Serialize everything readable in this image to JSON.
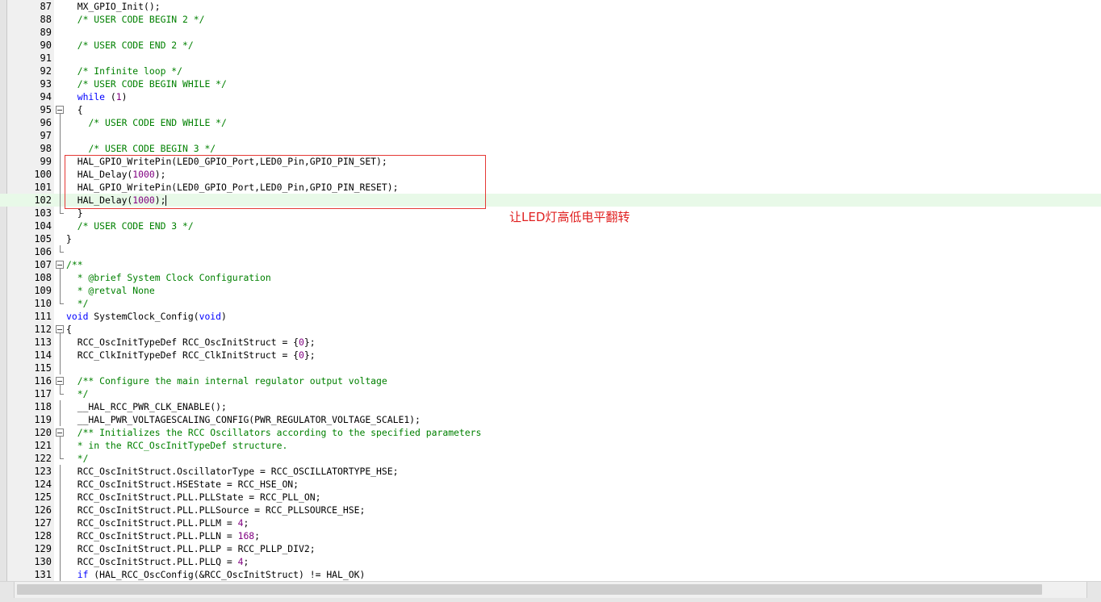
{
  "editor": {
    "lines": [
      {
        "n": "87",
        "code": [
          {
            "t": "  MX_GPIO_Init();"
          }
        ]
      },
      {
        "n": "88",
        "code": [
          {
            "t": "  "
          },
          {
            "t": "/* USER CODE BEGIN 2 */",
            "c": "cm"
          }
        ]
      },
      {
        "n": "89",
        "code": []
      },
      {
        "n": "90",
        "code": [
          {
            "t": "  "
          },
          {
            "t": "/* USER CODE END 2 */",
            "c": "cm"
          }
        ]
      },
      {
        "n": "91",
        "code": []
      },
      {
        "n": "92",
        "code": [
          {
            "t": "  "
          },
          {
            "t": "/* Infinite loop */",
            "c": "cm"
          }
        ]
      },
      {
        "n": "93",
        "code": [
          {
            "t": "  "
          },
          {
            "t": "/* USER CODE BEGIN WHILE */",
            "c": "cm"
          }
        ]
      },
      {
        "n": "94",
        "code": [
          {
            "t": "  "
          },
          {
            "t": "while",
            "c": "kw"
          },
          {
            "t": " ("
          },
          {
            "t": "1",
            "c": "num"
          },
          {
            "t": ")"
          }
        ]
      },
      {
        "n": "95",
        "code": [
          {
            "t": "  {"
          }
        ],
        "fold": "open"
      },
      {
        "n": "96",
        "code": [
          {
            "t": "    "
          },
          {
            "t": "/* USER CODE END WHILE */",
            "c": "cm"
          }
        ],
        "fold": "line"
      },
      {
        "n": "97",
        "code": [],
        "fold": "line"
      },
      {
        "n": "98",
        "code": [
          {
            "t": "    "
          },
          {
            "t": "/* USER CODE BEGIN 3 */",
            "c": "cm"
          }
        ],
        "fold": "line"
      },
      {
        "n": "99",
        "code": [
          {
            "t": "  HAL_GPIO_WritePin(LED0_GPIO_Port,LED0_Pin,GPIO_PIN_SET);"
          }
        ],
        "fold": "line"
      },
      {
        "n": "100",
        "code": [
          {
            "t": "  HAL_Delay("
          },
          {
            "t": "1000",
            "c": "num"
          },
          {
            "t": ");"
          }
        ],
        "fold": "line"
      },
      {
        "n": "101",
        "code": [
          {
            "t": "  HAL_GPIO_WritePin(LED0_GPIO_Port,LED0_Pin,GPIO_PIN_RESET);"
          }
        ],
        "fold": "line"
      },
      {
        "n": "102",
        "code": [
          {
            "t": "  HAL_Delay("
          },
          {
            "t": "1000",
            "c": "num"
          },
          {
            "t": ");"
          },
          {
            "caret": true
          }
        ],
        "fold": "line",
        "current": true
      },
      {
        "n": "103",
        "code": [
          {
            "t": "  }"
          }
        ],
        "fold": "end"
      },
      {
        "n": "104",
        "code": [
          {
            "t": "  "
          },
          {
            "t": "/* USER CODE END 3 */",
            "c": "cm"
          }
        ]
      },
      {
        "n": "105",
        "code": [
          {
            "t": "}"
          }
        ]
      },
      {
        "n": "106",
        "code": [],
        "fold": "end"
      },
      {
        "n": "107",
        "code": [
          {
            "t": "/**",
            "c": "cm"
          }
        ],
        "fold": "open"
      },
      {
        "n": "108",
        "code": [
          {
            "t": "  * @brief System Clock Configuration",
            "c": "cm"
          }
        ],
        "fold": "line"
      },
      {
        "n": "109",
        "code": [
          {
            "t": "  * @retval None",
            "c": "cm"
          }
        ],
        "fold": "line"
      },
      {
        "n": "110",
        "code": [
          {
            "t": "  */",
            "c": "cm"
          }
        ],
        "fold": "end"
      },
      {
        "n": "111",
        "code": [
          {
            "t": "void",
            "c": "kw"
          },
          {
            "t": " SystemClock_Config("
          },
          {
            "t": "void",
            "c": "kw"
          },
          {
            "t": ")"
          }
        ]
      },
      {
        "n": "112",
        "code": [
          {
            "t": "{"
          }
        ],
        "fold": "open"
      },
      {
        "n": "113",
        "code": [
          {
            "t": "  RCC_OscInitTypeDef RCC_OscInitStruct = {"
          },
          {
            "t": "0",
            "c": "num"
          },
          {
            "t": "};"
          }
        ],
        "fold": "line"
      },
      {
        "n": "114",
        "code": [
          {
            "t": "  RCC_ClkInitTypeDef RCC_ClkInitStruct = {"
          },
          {
            "t": "0",
            "c": "num"
          },
          {
            "t": "};"
          }
        ],
        "fold": "line"
      },
      {
        "n": "115",
        "code": [],
        "fold": "line"
      },
      {
        "n": "116",
        "code": [
          {
            "t": "  "
          },
          {
            "t": "/** Configure the main internal regulator output voltage",
            "c": "cm"
          }
        ],
        "fold": "open"
      },
      {
        "n": "117",
        "code": [
          {
            "t": "  "
          },
          {
            "t": "*/",
            "c": "cm"
          }
        ],
        "fold": "end"
      },
      {
        "n": "118",
        "code": [
          {
            "t": "  __HAL_RCC_PWR_CLK_ENABLE();"
          }
        ],
        "fold": "line"
      },
      {
        "n": "119",
        "code": [
          {
            "t": "  __HAL_PWR_VOLTAGESCALING_CONFIG(PWR_REGULATOR_VOLTAGE_SCALE1);"
          }
        ],
        "fold": "line"
      },
      {
        "n": "120",
        "code": [
          {
            "t": "  "
          },
          {
            "t": "/** Initializes the RCC Oscillators according to the specified parameters",
            "c": "cm"
          }
        ],
        "fold": "open"
      },
      {
        "n": "121",
        "code": [
          {
            "t": "  "
          },
          {
            "t": "* in the RCC_OscInitTypeDef structure.",
            "c": "cm"
          }
        ],
        "fold": "line"
      },
      {
        "n": "122",
        "code": [
          {
            "t": "  "
          },
          {
            "t": "*/",
            "c": "cm"
          }
        ],
        "fold": "end"
      },
      {
        "n": "123",
        "code": [
          {
            "t": "  RCC_OscInitStruct.OscillatorType = RCC_OSCILLATORTYPE_HSE;"
          }
        ],
        "fold": "line"
      },
      {
        "n": "124",
        "code": [
          {
            "t": "  RCC_OscInitStruct.HSEState = RCC_HSE_ON;"
          }
        ],
        "fold": "line"
      },
      {
        "n": "125",
        "code": [
          {
            "t": "  RCC_OscInitStruct.PLL.PLLState = RCC_PLL_ON;"
          }
        ],
        "fold": "line"
      },
      {
        "n": "126",
        "code": [
          {
            "t": "  RCC_OscInitStruct.PLL.PLLSource = RCC_PLLSOURCE_HSE;"
          }
        ],
        "fold": "line"
      },
      {
        "n": "127",
        "code": [
          {
            "t": "  RCC_OscInitStruct.PLL.PLLM = "
          },
          {
            "t": "4",
            "c": "num"
          },
          {
            "t": ";"
          }
        ],
        "fold": "line"
      },
      {
        "n": "128",
        "code": [
          {
            "t": "  RCC_OscInitStruct.PLL.PLLN = "
          },
          {
            "t": "168",
            "c": "num"
          },
          {
            "t": ";"
          }
        ],
        "fold": "line"
      },
      {
        "n": "129",
        "code": [
          {
            "t": "  RCC_OscInitStruct.PLL.PLLP = RCC_PLLP_DIV2;"
          }
        ],
        "fold": "line"
      },
      {
        "n": "130",
        "code": [
          {
            "t": "  RCC_OscInitStruct.PLL.PLLQ = "
          },
          {
            "t": "4",
            "c": "num"
          },
          {
            "t": ";"
          }
        ],
        "fold": "line"
      },
      {
        "n": "131",
        "code": [
          {
            "t": "  "
          },
          {
            "t": "if",
            "c": "kw"
          },
          {
            "t": " (HAL_RCC_OscConfig(&RCC_OscInitStruct) != HAL_OK)"
          }
        ],
        "fold": "line"
      }
    ]
  },
  "annotation": {
    "text": "让LED灯高低电平翻转",
    "color": "#e02020"
  },
  "colors": {
    "comment": "#008000",
    "keyword": "#0000ff",
    "number": "#800080",
    "current_line": "#e8f9e8",
    "highlight_box": "#e53935"
  }
}
